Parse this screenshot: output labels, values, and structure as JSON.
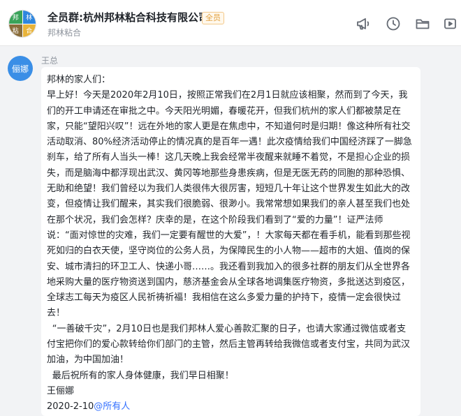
{
  "header": {
    "title": "全员群:杭州邦林粘合科技有限公司",
    "badge": "全员",
    "subtitle": "邦林粘合",
    "avatar_cells": [
      "邦",
      "林",
      "粘",
      "合"
    ],
    "tools": [
      "announcement-icon",
      "history-icon",
      "folder-icon",
      "video-icon"
    ]
  },
  "message": {
    "avatar_text": "俪娜",
    "sender": "王总",
    "greeting": "邦林的家人们：",
    "paragraph1": "早上好！今天是2020年2月10日，按照正常我们在2月1日就应该相聚，然而到了今天，我们的开工申请还在审批之中。今天阳光明媚，春暖花开，但我们杭州的家人们都被禁足在家，只能“望阳兴叹”！远在外地的家人更是在焦虑中，不知道何时是归期！像这种所有社交活动取消、80%经济活动停止的情况真的是百年一遇！此次疫情给我们中国经济踩了一脚急刹车，给了所有人当头一棒！这几天晚上我会经常半夜醒来就睡不着觉，不是担心企业的损失，而是脑海中都浮现出武汉、黄冈等地那些身患疾病，但是无医无药的同胞的那种恐惧、无助和绝望！我们曾经以为我们人类很伟大很厉害，短短几十年让这个世界发生如此大的改变，但疫情让我们醒来，其实我们很脆弱、很渺小。我常常想如果我们的亲人甚至我们也处在那个状况，我们会怎样？庆幸的是，在这个阶段我们看到了“爱的力量”！证严法师说：“面对惊世的灾难，我们一定要有醒世的大爱”，！大家每天都在看手机，能看到那些视死如归的白衣天使，坚守岗位的公务人员，为保障民生的小人物——超市的大姐、值岗的保安、城市清扫的环卫工人、快递小哥……。我还看到我加入的很多社群的朋友们从全世界各地采购大量的医疗物资送到国内，慈济基金会从全球各地调集医疗物资，多批送达到疫区，全球志工每天为疫区人民祈祷祈福！我相信在这么多爱力量的护持下，疫情一定会很快过去！",
    "paragraph2": "“一善破千灾”，2月10日也是我们邦林人爱心善款汇聚的日子，也请大家通过微信或者支付宝把你们的爱心款转给你们部门的主管，然后主管再转给我微信或者支付宝，共同为武汉加油，为中国加油！",
    "paragraph3": "最后祝所有的家人身体健康，我们早日相聚！",
    "signature": "王俪娜",
    "date": "2020-2-10",
    "mention": "@所有人"
  },
  "colors": {
    "accent": "#3370ff",
    "badge": "#e2a03f",
    "avatar": "#3a8ee6"
  }
}
